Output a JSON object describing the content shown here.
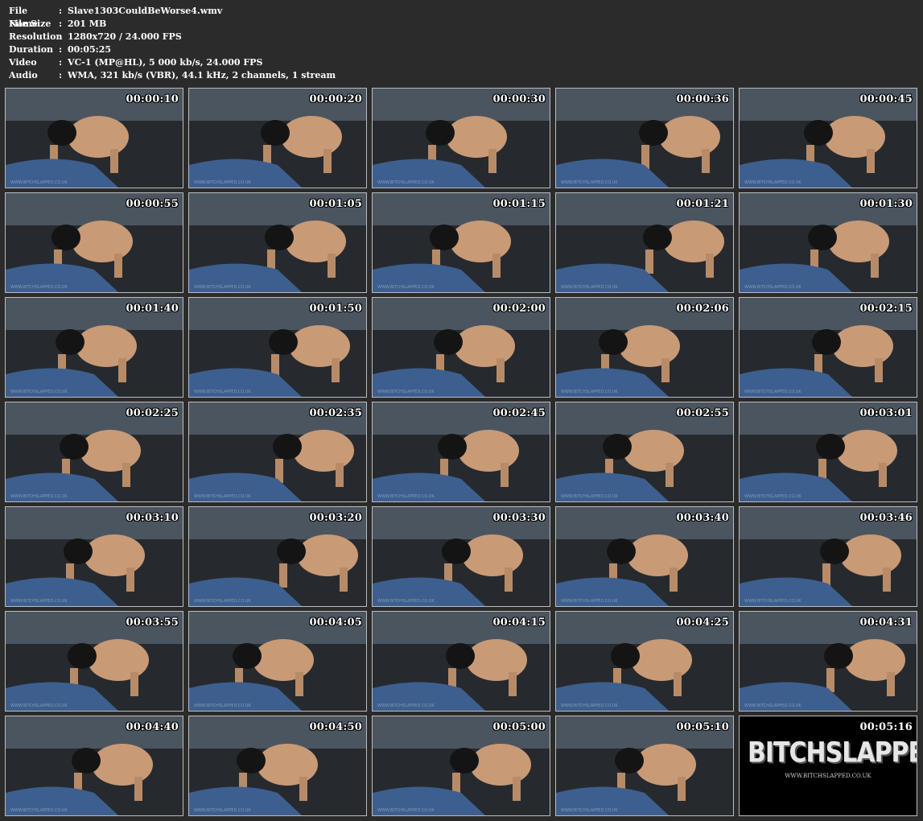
{
  "info": [
    {
      "label": "File Name",
      "value": "Slave1303CouldBeWorse4.wmv"
    },
    {
      "label": "File Size",
      "value": "201 MB"
    },
    {
      "label": "Resolution",
      "value": "1280x720 / 24.000 FPS"
    },
    {
      "label": "Duration",
      "value": "00:05:25"
    },
    {
      "label": "Video",
      "value": "VC-1 (MP@HL), 5 000 kb/s, 24.000 FPS"
    },
    {
      "label": "Audio",
      "value": "WMA, 321 kb/s (VBR), 44.1 kHz, 2 channels, 1 stream"
    }
  ],
  "separator": ":",
  "thumbnails": [
    "00:00:10",
    "00:00:20",
    "00:00:30",
    "00:00:36",
    "00:00:45",
    "00:00:55",
    "00:01:05",
    "00:01:15",
    "00:01:21",
    "00:01:30",
    "00:01:40",
    "00:01:50",
    "00:02:00",
    "00:02:06",
    "00:02:15",
    "00:02:25",
    "00:02:35",
    "00:02:45",
    "00:02:55",
    "00:03:01",
    "00:03:10",
    "00:03:20",
    "00:03:30",
    "00:03:40",
    "00:03:46",
    "00:03:55",
    "00:04:05",
    "00:04:15",
    "00:04:25",
    "00:04:31",
    "00:04:40",
    "00:04:50",
    "00:05:00",
    "00:05:10",
    "00:05:16"
  ],
  "logo": {
    "text": "BITCHSLAPPED",
    "url": "WWW.BITCHSLAPPED.CO.UK"
  },
  "colors": {
    "background": "#2b2b2b",
    "thumb_border": "#bcbcbc",
    "text": "#ffffff"
  }
}
